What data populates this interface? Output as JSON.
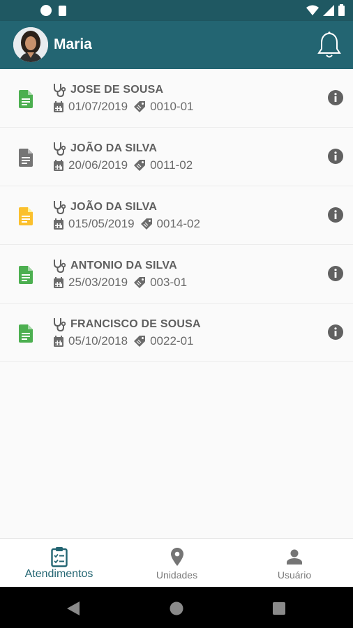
{
  "header": {
    "user_name": "Maria"
  },
  "colors": {
    "statusbar": "#1f5862",
    "appbar": "#236572",
    "doc_green": "#4caf50",
    "doc_gray": "#757575",
    "doc_yellow": "#fbc02d",
    "accent": "#236572"
  },
  "items": [
    {
      "name": "JOSE DE SOUSA",
      "date": "01/07/2019",
      "code": "0010-01",
      "doc_icon": "document-green-icon"
    },
    {
      "name": "JOÃO DA SILVA",
      "date": "20/06/2019",
      "code": "0011-02",
      "doc_icon": "document-gray-icon"
    },
    {
      "name": "JOÃO DA SILVA",
      "date": "015/05/2019",
      "code": "0014-02",
      "doc_icon": "document-yellow-icon"
    },
    {
      "name": "ANTONIO DA SILVA",
      "date": "25/03/2019",
      "code": "003-01",
      "doc_icon": "document-green-icon"
    },
    {
      "name": "FRANCISCO DE SOUSA",
      "date": "05/10/2018",
      "code": "0022-01",
      "doc_icon": "document-green-icon"
    }
  ],
  "bottom_nav": [
    {
      "label": "Atendimentos",
      "icon": "clipboard-icon",
      "active": true
    },
    {
      "label": "Unidades",
      "icon": "map-pin-icon",
      "active": false
    },
    {
      "label": "Usuário",
      "icon": "person-icon",
      "active": false
    }
  ]
}
